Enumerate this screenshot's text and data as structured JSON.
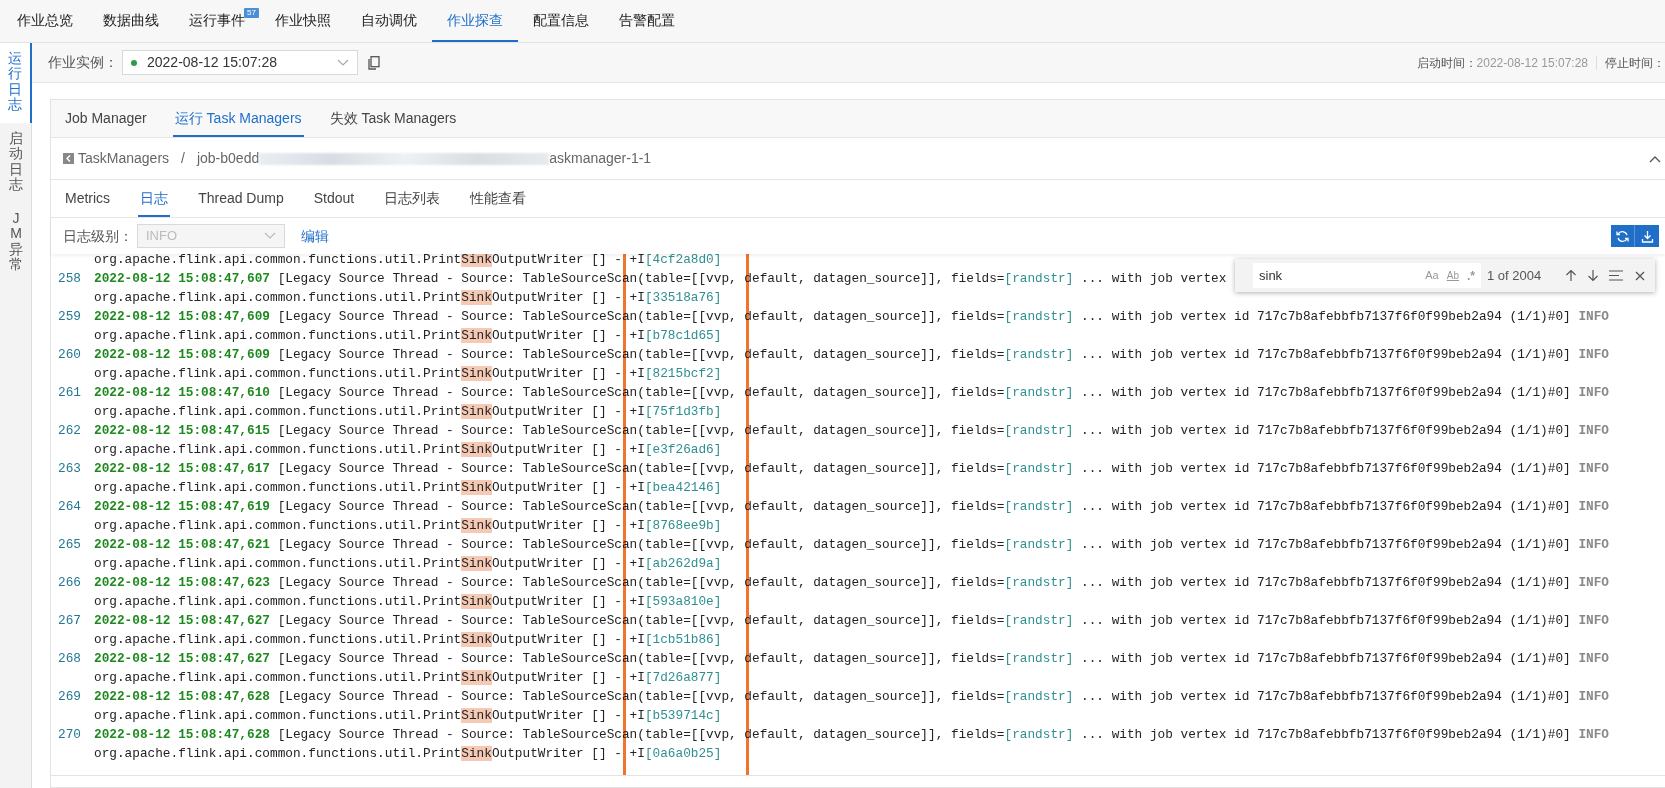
{
  "top_tabs": [
    {
      "label": "作业总览",
      "selected": false
    },
    {
      "label": "数据曲线",
      "selected": false
    },
    {
      "label": "运行事件",
      "selected": false,
      "badge": "57"
    },
    {
      "label": "作业快照",
      "selected": false
    },
    {
      "label": "自动调优",
      "selected": false
    },
    {
      "label": "作业探查",
      "selected": true
    },
    {
      "label": "配置信息",
      "selected": false
    },
    {
      "label": "告警配置",
      "selected": false
    }
  ],
  "side_tabs": [
    {
      "label": "运行日志",
      "selected": true
    },
    {
      "label": "启动日志",
      "selected": false
    },
    {
      "label": "JM异常",
      "selected": false
    }
  ],
  "instance": {
    "label": "作业实例：",
    "value": "2022-08-12 15:07:28",
    "running": true
  },
  "times": [
    {
      "label": "启动时间：",
      "value": "2022-08-12 15:07:28"
    },
    {
      "label": "停止时间："
    }
  ],
  "panel_tabs": [
    {
      "label": "Job Manager",
      "selected": false
    },
    {
      "label": "运行 Task Managers",
      "selected": true
    },
    {
      "label": "失效 Task Managers",
      "selected": false
    }
  ],
  "breadcrumb": {
    "root": "TaskManagers",
    "separator": "/",
    "job_start": "job-b0edd",
    "job_end": "askmanager-1-1"
  },
  "sub_tabs": [
    {
      "label": "Metrics",
      "selected": false
    },
    {
      "label": "日志",
      "selected": true
    },
    {
      "label": "Thread Dump",
      "selected": false
    },
    {
      "label": "Stdout",
      "selected": false
    },
    {
      "label": "日志列表",
      "selected": false
    },
    {
      "label": "性能查看",
      "selected": false
    }
  ],
  "log_level": {
    "label": "日志级别：",
    "value": "INFO",
    "disabled": true,
    "edit_link": "编辑"
  },
  "find": {
    "value": "sink",
    "options": [
      "Aa",
      "Ab",
      ".*"
    ],
    "count": "1 of 2004"
  },
  "log": {
    "head": {
      "writer": "org.apache.flink.api.common.functions.util.Print",
      "match": "Sink",
      "writer_end": "OutputWriter [] - +I",
      "row": "[4cf2a8d0]"
    },
    "entries": [
      {
        "line_no": "258",
        "timestamp": "2022-08-12 15:08:47,607",
        "source": " [Legacy Source Thread - Source: TableSourceScan(table=[[vvp, default, datagen_source]], fields=",
        "field": "[randstr]",
        "tail": " ... with job vertex",
        "writer": "org.apache.flink.api.common.functions.util.Print",
        "match": "Sink",
        "writer_end": "OutputWriter [] - +I",
        "row": "[33518a76]"
      },
      {
        "line_no": "259",
        "timestamp": "2022-08-12 15:08:47,609",
        "source": " [Legacy Source Thread - Source: TableSourceScan(table=[[vvp, default, datagen_source]], fields=",
        "field": "[randstr]",
        "tail": " ... with job vertex id 717c7b8afebbfb7137f6f0f99beb2a94 (1/1)#0]",
        "level": "INFO",
        "writer": "org.apache.flink.api.common.functions.util.Print",
        "match": "Sink",
        "writer_end": "OutputWriter [] - +I",
        "row": "[b78c1d65]"
      },
      {
        "line_no": "260",
        "timestamp": "2022-08-12 15:08:47,609",
        "source": " [Legacy Source Thread - Source: TableSourceScan(table=[[vvp, default, datagen_source]], fields=",
        "field": "[randstr]",
        "tail": " ... with job vertex id 717c7b8afebbfb7137f6f0f99beb2a94 (1/1)#0]",
        "level": "INFO",
        "writer": "org.apache.flink.api.common.functions.util.Print",
        "match": "Sink",
        "writer_end": "OutputWriter [] - +I",
        "row": "[8215bcf2]"
      },
      {
        "line_no": "261",
        "timestamp": "2022-08-12 15:08:47,610",
        "source": " [Legacy Source Thread - Source: TableSourceScan(table=[[vvp, default, datagen_source]], fields=",
        "field": "[randstr]",
        "tail": " ... with job vertex id 717c7b8afebbfb7137f6f0f99beb2a94 (1/1)#0]",
        "level": "INFO",
        "writer": "org.apache.flink.api.common.functions.util.Print",
        "match": "Sink",
        "writer_end": "OutputWriter [] - +I",
        "row": "[75f1d3fb]"
      },
      {
        "line_no": "262",
        "timestamp": "2022-08-12 15:08:47,615",
        "source": " [Legacy Source Thread - Source: TableSourceScan(table=[[vvp, default, datagen_source]], fields=",
        "field": "[randstr]",
        "tail": " ... with job vertex id 717c7b8afebbfb7137f6f0f99beb2a94 (1/1)#0]",
        "level": "INFO",
        "writer": "org.apache.flink.api.common.functions.util.Print",
        "match": "Sink",
        "writer_end": "OutputWriter [] - +I",
        "row": "[e3f26ad6]"
      },
      {
        "line_no": "263",
        "timestamp": "2022-08-12 15:08:47,617",
        "source": " [Legacy Source Thread - Source: TableSourceScan(table=[[vvp, default, datagen_source]], fields=",
        "field": "[randstr]",
        "tail": " ... with job vertex id 717c7b8afebbfb7137f6f0f99beb2a94 (1/1)#0]",
        "level": "INFO",
        "writer": "org.apache.flink.api.common.functions.util.Print",
        "match": "Sink",
        "writer_end": "OutputWriter [] - +I",
        "row": "[bea42146]"
      },
      {
        "line_no": "264",
        "timestamp": "2022-08-12 15:08:47,619",
        "source": " [Legacy Source Thread - Source: TableSourceScan(table=[[vvp, default, datagen_source]], fields=",
        "field": "[randstr]",
        "tail": " ... with job vertex id 717c7b8afebbfb7137f6f0f99beb2a94 (1/1)#0]",
        "level": "INFO",
        "writer": "org.apache.flink.api.common.functions.util.Print",
        "match": "Sink",
        "writer_end": "OutputWriter [] - +I",
        "row": "[8768ee9b]"
      },
      {
        "line_no": "265",
        "timestamp": "2022-08-12 15:08:47,621",
        "source": " [Legacy Source Thread - Source: TableSourceScan(table=[[vvp, default, datagen_source]], fields=",
        "field": "[randstr]",
        "tail": " ... with job vertex id 717c7b8afebbfb7137f6f0f99beb2a94 (1/1)#0]",
        "level": "INFO",
        "writer": "org.apache.flink.api.common.functions.util.Print",
        "match": "Sink",
        "writer_end": "OutputWriter [] - +I",
        "row": "[ab262d9a]"
      },
      {
        "line_no": "266",
        "timestamp": "2022-08-12 15:08:47,623",
        "source": " [Legacy Source Thread - Source: TableSourceScan(table=[[vvp, default, datagen_source]], fields=",
        "field": "[randstr]",
        "tail": " ... with job vertex id 717c7b8afebbfb7137f6f0f99beb2a94 (1/1)#0]",
        "level": "INFO",
        "writer": "org.apache.flink.api.common.functions.util.Print",
        "match": "Sink",
        "writer_end": "OutputWriter [] - +I",
        "row": "[593a810e]"
      },
      {
        "line_no": "267",
        "timestamp": "2022-08-12 15:08:47,627",
        "source": " [Legacy Source Thread - Source: TableSourceScan(table=[[vvp, default, datagen_source]], fields=",
        "field": "[randstr]",
        "tail": " ... with job vertex id 717c7b8afebbfb7137f6f0f99beb2a94 (1/1)#0]",
        "level": "INFO",
        "writer": "org.apache.flink.api.common.functions.util.Print",
        "match": "Sink",
        "writer_end": "OutputWriter [] - +I",
        "row": "[1cb51b86]"
      },
      {
        "line_no": "268",
        "timestamp": "2022-08-12 15:08:47,627",
        "source": " [Legacy Source Thread - Source: TableSourceScan(table=[[vvp, default, datagen_source]], fields=",
        "field": "[randstr]",
        "tail": " ... with job vertex id 717c7b8afebbfb7137f6f0f99beb2a94 (1/1)#0]",
        "level": "INFO",
        "writer": "org.apache.flink.api.common.functions.util.Print",
        "match": "Sink",
        "writer_end": "OutputWriter [] - +I",
        "row": "[7d26a877]"
      },
      {
        "line_no": "269",
        "timestamp": "2022-08-12 15:08:47,628",
        "source": " [Legacy Source Thread - Source: TableSourceScan(table=[[vvp, default, datagen_source]], fields=",
        "field": "[randstr]",
        "tail": " ... with job vertex id 717c7b8afebbfb7137f6f0f99beb2a94 (1/1)#0]",
        "level": "INFO",
        "writer": "org.apache.flink.api.common.functions.util.Print",
        "match": "Sink",
        "writer_end": "OutputWriter [] - +I",
        "row": "[b539714c]"
      },
      {
        "line_no": "270",
        "timestamp": "2022-08-12 15:08:47,628",
        "source": " [Legacy Source Thread - Source: TableSourceScan(table=[[vvp, default, datagen_source]], fields=",
        "field": "[randstr]",
        "tail": " ... with job vertex id 717c7b8afebbfb7137f6f0f99beb2a94 (1/1)#0]",
        "level": "INFO",
        "writer": "org.apache.flink.api.common.functions.util.Print",
        "match": "Sink",
        "writer_end": "OutputWriter [] - +I",
        "row": "[0a6a0b25]"
      }
    ]
  }
}
